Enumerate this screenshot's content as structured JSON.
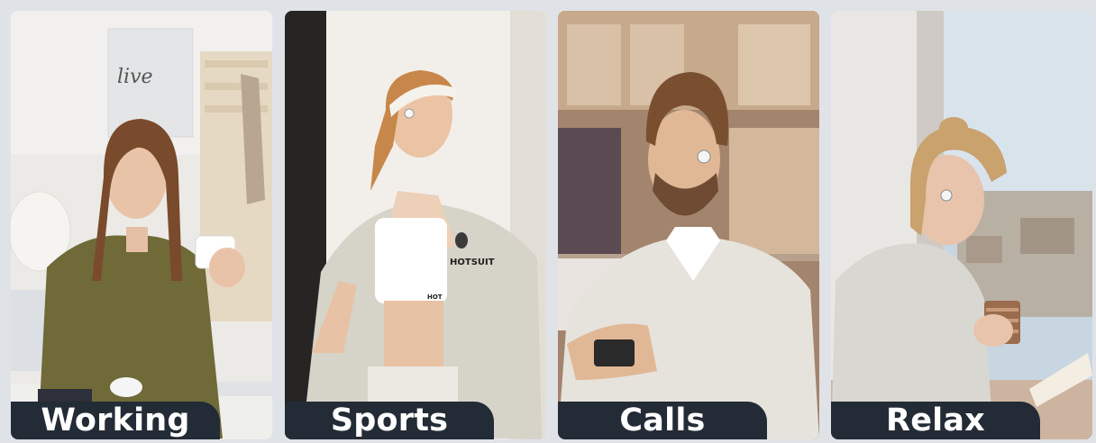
{
  "scenes": [
    {
      "label": "Working",
      "sign_text": "live"
    },
    {
      "label": "Sports",
      "shirt_text": "HOTSUIT",
      "top_text": "HOT"
    },
    {
      "label": "Calls"
    },
    {
      "label": "Relax"
    }
  ]
}
